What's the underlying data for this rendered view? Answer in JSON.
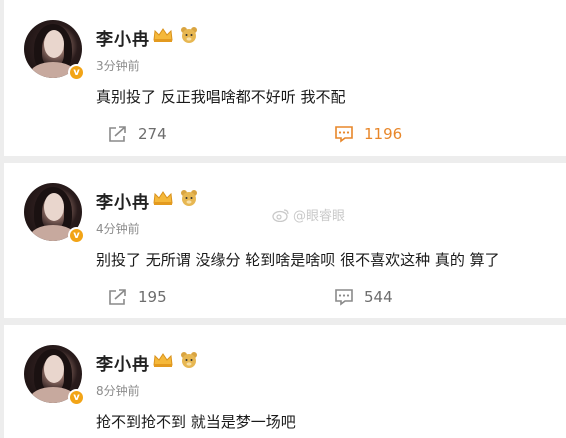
{
  "posts": [
    {
      "username": "李小冉",
      "time": "3分钟前",
      "content": "真别投了 反正我唱啥都不好听 我不配",
      "share_count": "274",
      "comment_count": "1196",
      "comment_highlighted": true
    },
    {
      "username": "李小冉",
      "time": "4分钟前",
      "content": "别投了 无所谓 没缘分 轮到啥是啥呗 很不喜欢这种 真的  算了",
      "share_count": "195",
      "comment_count": "544",
      "comment_highlighted": false
    },
    {
      "username": "李小冉",
      "time": "8分钟前",
      "content": "抢不到抢不到 就当是梦一场吧"
    }
  ],
  "watermark": "@眼睿眼",
  "colors": {
    "verify_badge": "#f2a416",
    "highlight": "#e8872a"
  },
  "icons": [
    "avatar",
    "verified-badge-icon",
    "crown-icon",
    "bear-icon",
    "share-icon",
    "comment-icon",
    "weibo-icon"
  ]
}
